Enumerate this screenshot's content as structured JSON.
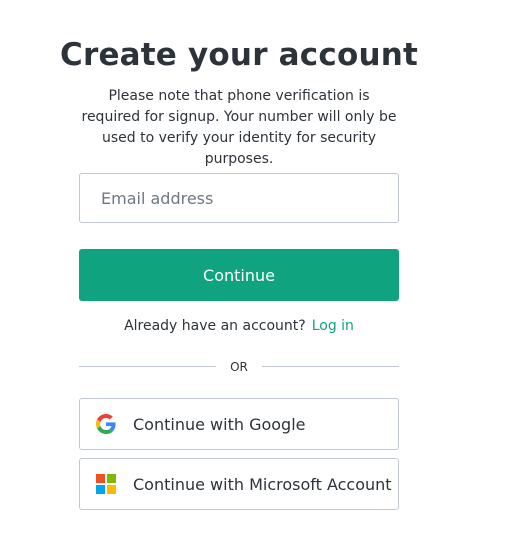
{
  "header": {
    "title": "Create your account",
    "subtitle": "Please note that phone verification is required for signup. Your number will only be used to verify your identity for security purposes."
  },
  "form": {
    "email_placeholder": "Email address",
    "email_value": "",
    "continue_label": "Continue"
  },
  "login": {
    "prompt": "Already have an account?",
    "link_label": "Log in"
  },
  "divider": {
    "label": "OR"
  },
  "social": {
    "google_label": "Continue with Google",
    "google_icon": "google-g-icon",
    "microsoft_label": "Continue with Microsoft Account",
    "microsoft_icon": "microsoft-logo-icon"
  },
  "colors": {
    "accent": "#10a37f",
    "text": "#2d333a",
    "border": "#c2c8d0",
    "google_blue": "#4285F4",
    "google_red": "#EA4335",
    "google_yellow": "#FBBC05",
    "google_green": "#34A853",
    "ms_red": "#F25022",
    "ms_green": "#7FBA00",
    "ms_blue": "#00A4EF",
    "ms_yellow": "#FFB900"
  }
}
